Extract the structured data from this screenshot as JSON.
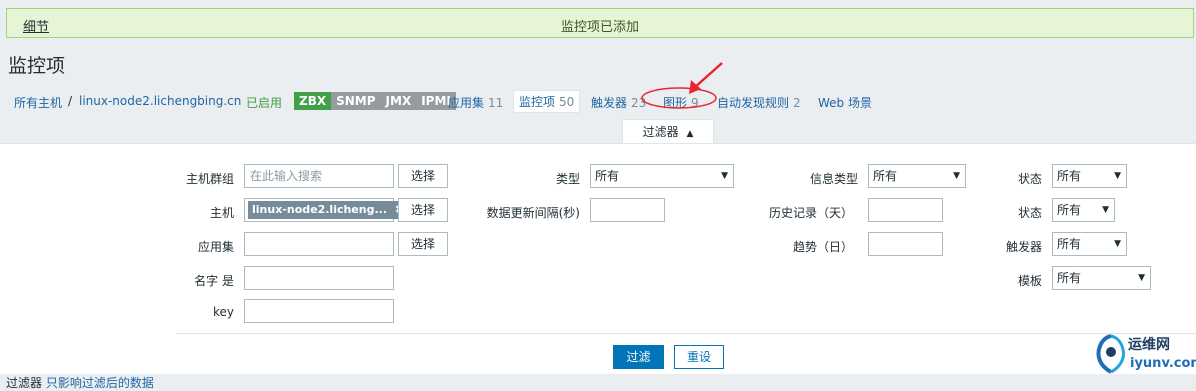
{
  "banner": {
    "details": "细节",
    "message": "监控项已添加"
  },
  "page_title": "监控项",
  "hostnav": {
    "all_hosts": "所有主机",
    "separator": "/",
    "host": "linux-node2.lichengbing.cn",
    "status": "已启用",
    "tags": [
      {
        "label": "ZBX",
        "active": true
      },
      {
        "label": "SNMP",
        "active": false
      },
      {
        "label": "JMX",
        "active": false
      },
      {
        "label": "IPMI",
        "active": false
      }
    ],
    "tabs": {
      "applications": {
        "label": "应用集",
        "count": "11"
      },
      "items": {
        "label": "监控项",
        "count": "50"
      },
      "triggers": {
        "label": "触发器",
        "count": "23"
      },
      "graphs": {
        "label": "图形",
        "count": "9"
      },
      "discovery": {
        "label": "自动发现规则",
        "count": "2"
      },
      "web": {
        "label": "Web 场景"
      }
    }
  },
  "filter": {
    "tab_label": "过滤器",
    "tab_icon": "caret-up-icon",
    "host_group": {
      "label": "主机群组",
      "placeholder": "在此输入搜索",
      "button": "选择"
    },
    "host": {
      "label": "主机",
      "chip": "linux-node2.licheng...",
      "chip_remove": "✖",
      "button": "选择"
    },
    "application": {
      "label": "应用集",
      "value": "",
      "button": "选择"
    },
    "name": {
      "label": "名字 是",
      "value": ""
    },
    "key": {
      "label": "key",
      "value": ""
    },
    "type": {
      "label": "类型",
      "value": "所有"
    },
    "update_interval": {
      "label": "数据更新间隔(秒)",
      "value": ""
    },
    "info_type": {
      "label": "信息类型",
      "value": "所有"
    },
    "history": {
      "label": "历史记录（天）",
      "value": ""
    },
    "trends": {
      "label": "趋势（日）",
      "value": ""
    },
    "state": {
      "label": "状态",
      "value": "所有"
    },
    "status": {
      "label": "状态",
      "value": "所有"
    },
    "triggers": {
      "label": "触发器",
      "value": "所有"
    },
    "template": {
      "label": "模板",
      "value": "所有"
    },
    "apply_button": "过滤",
    "reset_button": "重设"
  },
  "bottom_text": {
    "prefix": "过滤器",
    "rest": "只影响过滤后的数据"
  },
  "annotation_color": "#e8262d",
  "watermark": {
    "line1": "运维网",
    "line2": "iyunv.com"
  }
}
